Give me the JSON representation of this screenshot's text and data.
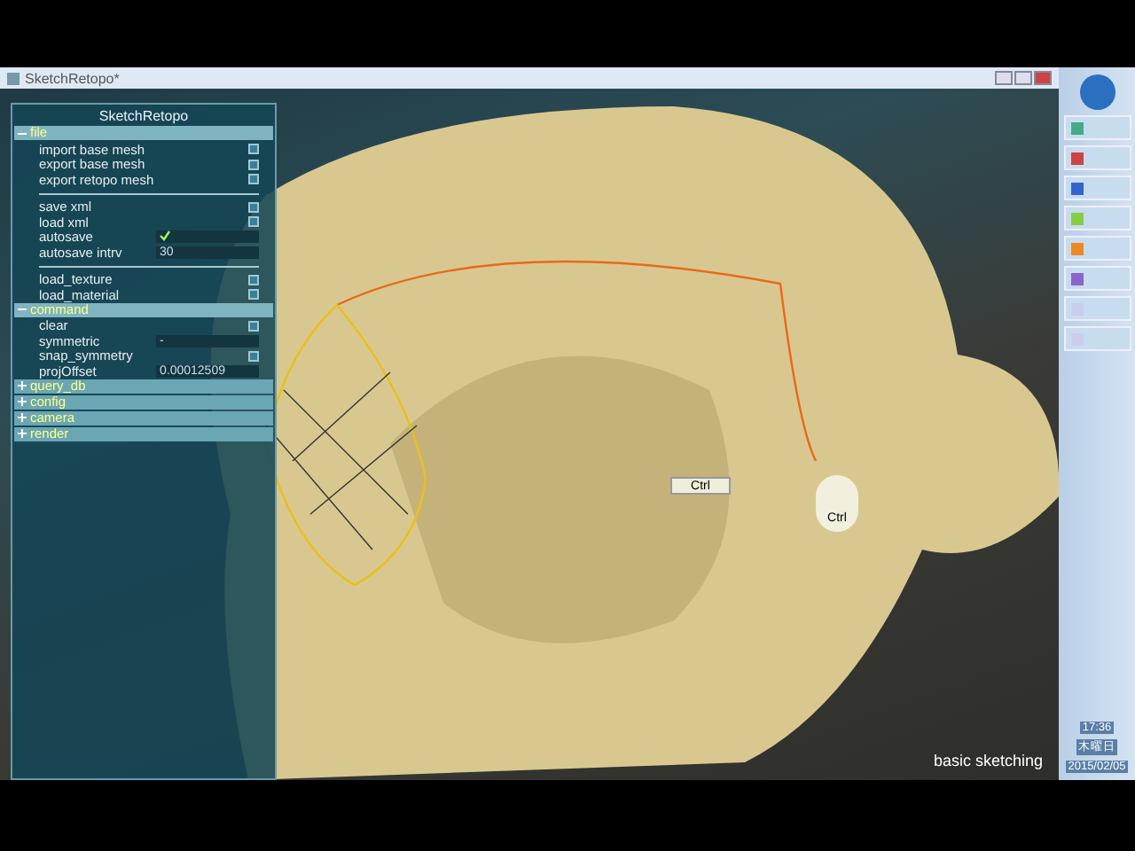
{
  "window": {
    "title": "SketchRetopo*"
  },
  "panel": {
    "title": "SketchRetopo",
    "sections": [
      {
        "label": "file",
        "expanded": true,
        "groups": [
          [
            {
              "kind": "action",
              "label": "import base mesh"
            },
            {
              "kind": "action",
              "label": "export base mesh"
            },
            {
              "kind": "action",
              "label": "export retopo mesh"
            }
          ],
          [
            {
              "kind": "action",
              "label": "save xml"
            },
            {
              "kind": "action",
              "label": "load xml"
            },
            {
              "kind": "check",
              "label": "autosave",
              "checked": true
            },
            {
              "kind": "value",
              "label": "autosave intrv",
              "value": "30"
            }
          ],
          [
            {
              "kind": "action",
              "label": "load_texture"
            },
            {
              "kind": "action",
              "label": "load_material"
            }
          ]
        ]
      },
      {
        "label": "command",
        "expanded": true,
        "groups": [
          [
            {
              "kind": "action",
              "label": "clear"
            },
            {
              "kind": "value",
              "label": "symmetric",
              "value": "-"
            },
            {
              "kind": "action",
              "label": "snap_symmetry"
            },
            {
              "kind": "value",
              "label": "projOffset",
              "value": "0.00012509"
            }
          ]
        ]
      },
      {
        "label": "query_db",
        "expanded": false
      },
      {
        "label": "config",
        "expanded": false
      },
      {
        "label": "camera",
        "expanded": false
      },
      {
        "label": "render",
        "expanded": false
      }
    ]
  },
  "viewport": {
    "key_badge": "Ctrl",
    "mouse_label": "Ctrl",
    "caption": "basic sketching"
  },
  "taskbar": {
    "time": "17:36",
    "weekday": "木曜日",
    "date": "2015/02/05"
  }
}
